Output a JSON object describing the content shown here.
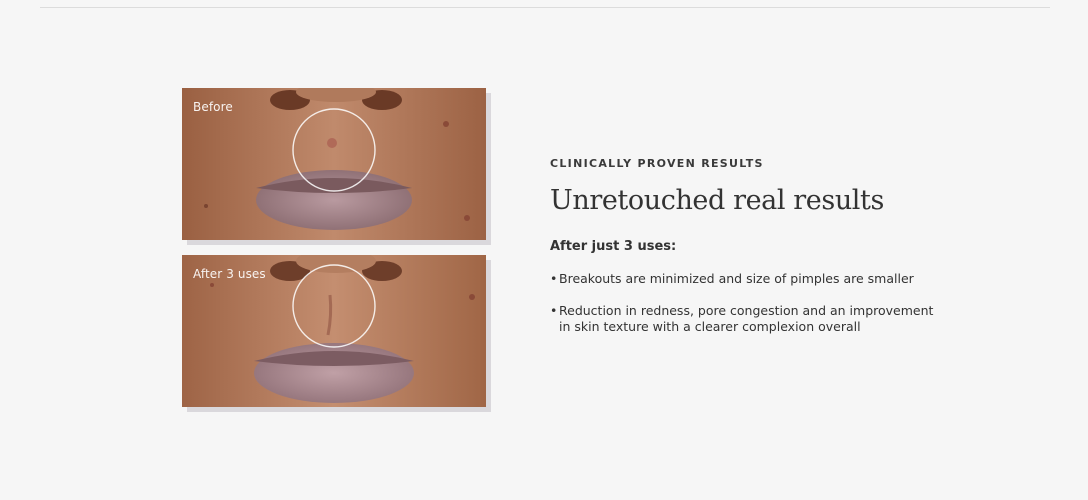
{
  "gallery": {
    "before": {
      "label": "Before"
    },
    "after": {
      "label": "After 3 uses"
    }
  },
  "results": {
    "eyebrow": "CLINICALLY PROVEN RESULTS",
    "headline": "Unretouched real results",
    "subhead": "After just 3 uses:",
    "bullet_marker": "•",
    "bullets": [
      "Breakouts are minimized and size of pimples are smaller",
      "Reduction in redness, pore congestion and an improvement in skin texture with a clearer complexion overall"
    ]
  }
}
